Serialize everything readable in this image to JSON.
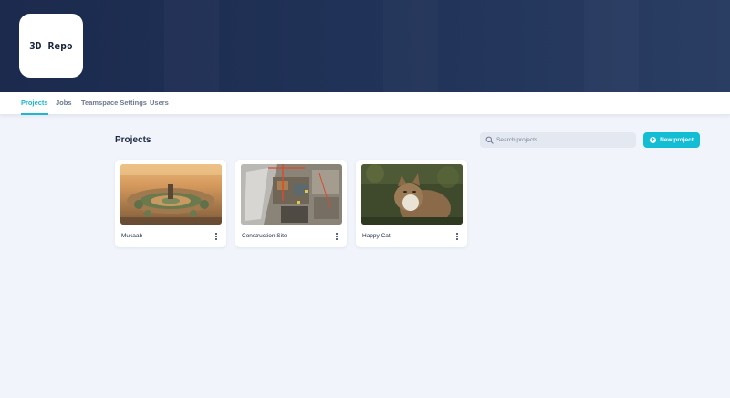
{
  "app": {
    "logo_text": "3D Repo"
  },
  "tabs": [
    {
      "label": "Projects",
      "active": true
    },
    {
      "label": "Jobs",
      "active": false
    },
    {
      "label": "Teamspace Settings",
      "active": false
    },
    {
      "label": "Users",
      "active": false
    }
  ],
  "main": {
    "title": "Projects",
    "search": {
      "placeholder": "Search projects...",
      "icon": "search-icon"
    },
    "new_project_label": "New project",
    "projects": [
      {
        "name": "Mukaab",
        "image": "aerial-city"
      },
      {
        "name": "Construction Site",
        "image": "construction-site"
      },
      {
        "name": "Happy Cat",
        "image": "cat-photo"
      }
    ]
  },
  "colors": {
    "banner": "#1b2a4d",
    "accent": "#13bdd4",
    "active_tab": "#1fb6cf",
    "background": "#f1f4fb"
  }
}
